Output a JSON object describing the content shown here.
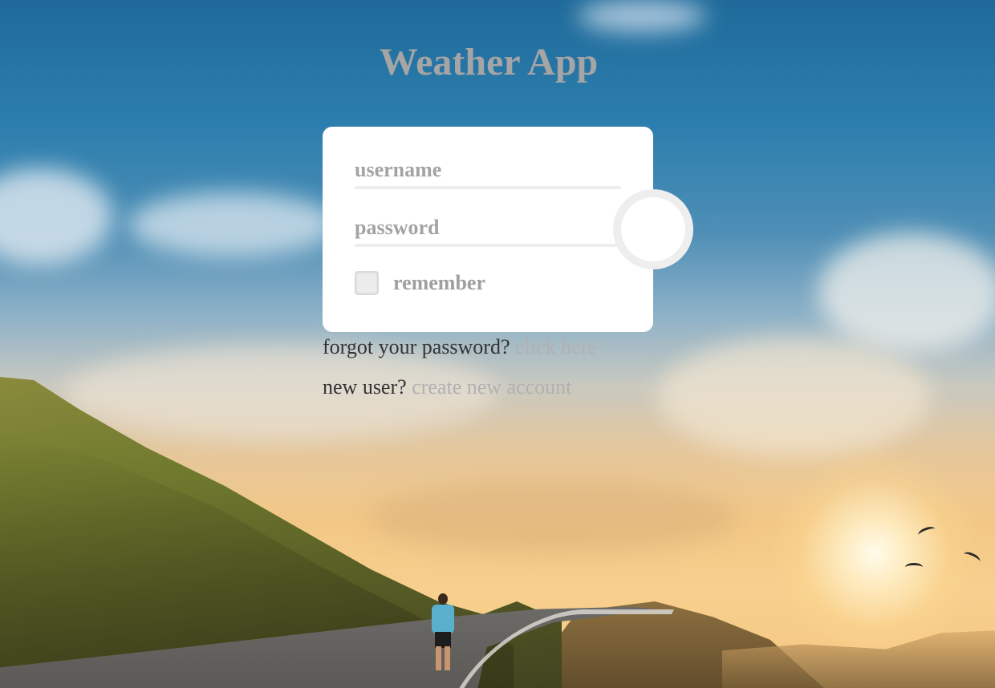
{
  "app": {
    "title": "Weather App"
  },
  "login": {
    "username_placeholder": "username",
    "password_placeholder": "password",
    "remember_label": "remember",
    "remember_checked": false
  },
  "links": {
    "forgot_prefix": "forgot your password?",
    "forgot_link": "click here",
    "new_user_prefix": "new user?",
    "new_user_link": "create new account"
  },
  "colors": {
    "title": "#a5a5a5",
    "card_background": "#ffffff",
    "field_underline": "#eeeeee",
    "link": "#b1b1b1",
    "text": "#333333"
  },
  "icons": {
    "submit": "circle-button"
  }
}
